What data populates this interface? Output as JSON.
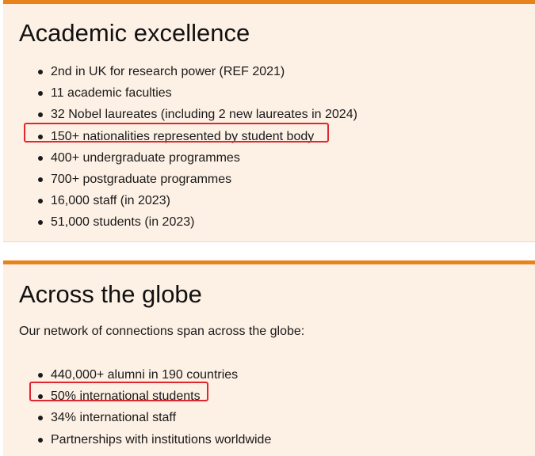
{
  "academic": {
    "heading": "Academic excellence",
    "items": [
      "2nd in UK for research power (REF 2021)",
      "11 academic faculties",
      "32 Nobel laureates (including 2 new laureates in 2024)",
      "150+ nationalities represented by student body",
      "400+ undergraduate programmes",
      "700+ postgraduate programmes",
      "16,000 staff (in 2023)",
      "51,000 students (in 2023)"
    ]
  },
  "globe": {
    "heading": "Across the globe",
    "intro": "Our network of connections span across the globe:",
    "items": [
      "440,000+ alumni in 190 countries",
      "50% international students",
      "34% international staff",
      "Partnerships with institutions worldwide"
    ]
  },
  "colors": {
    "accent_border": "#e8831c",
    "card_background": "#fdf0e4",
    "highlight_box": "#e0262e"
  }
}
